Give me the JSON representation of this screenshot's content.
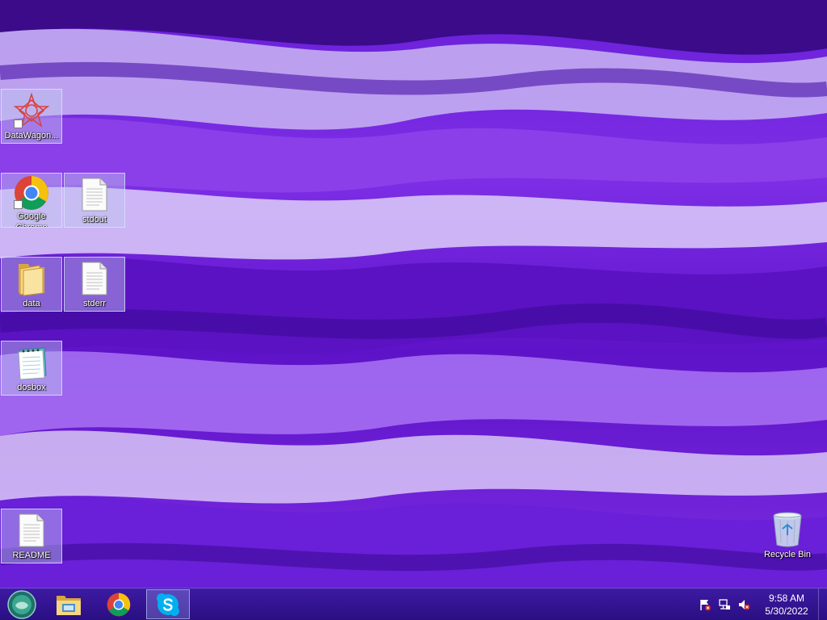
{
  "desktop": {
    "icons": [
      {
        "label": "DataWagon...",
        "icon": "datawagon-icon"
      },
      {
        "label": "Google Chrome",
        "icon": "chrome-icon"
      },
      {
        "label": "stdout",
        "icon": "text-file-icon"
      },
      {
        "label": "data",
        "icon": "folder-icon"
      },
      {
        "label": "stderr",
        "icon": "text-file-icon"
      },
      {
        "label": "dosbox",
        "icon": "notepad-icon"
      },
      {
        "label": "README",
        "icon": "text-file-icon"
      },
      {
        "label": "Recycle Bin",
        "icon": "recycle-bin-icon"
      }
    ]
  },
  "taskbar": {
    "buttons": [
      {
        "icon": "start-orb-icon"
      },
      {
        "icon": "file-explorer-icon"
      },
      {
        "icon": "chrome-icon"
      },
      {
        "icon": "skype-icon",
        "active": true
      }
    ],
    "tray": [
      "action-center-flag-icon",
      "network-icon",
      "volume-muted-icon"
    ],
    "clock": {
      "time": "9:58 AM",
      "date": "5/30/2022"
    }
  },
  "colors": {
    "wallpaper": "#6a1fd8",
    "taskbar": "#2a0f82",
    "chrome_red": "#db4437",
    "chrome_yellow": "#f4c20d",
    "chrome_green": "#0f9d58",
    "chrome_blue": "#4285f4",
    "skype_blue": "#00aff0"
  }
}
